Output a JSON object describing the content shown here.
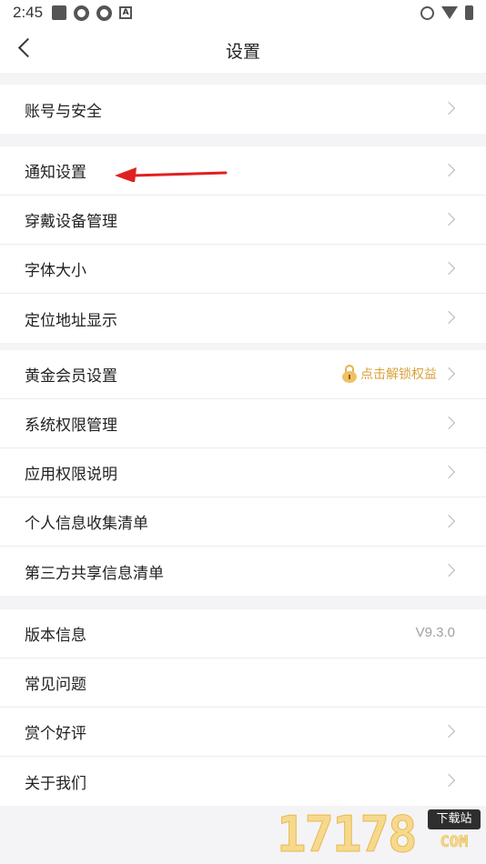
{
  "status_bar": {
    "time": "2:45",
    "left_icons": [
      "notification-square-icon",
      "app-circle-icon",
      "app-circle-icon",
      "app-a-icon"
    ],
    "right_icons": [
      "alarm-icon",
      "wifi-icon",
      "battery-icon"
    ]
  },
  "header": {
    "title": "设置",
    "back_icon": "chevron-left-icon"
  },
  "sections": [
    {
      "items": [
        {
          "label": "账号与安全"
        }
      ]
    },
    {
      "items": [
        {
          "label": "通知设置"
        },
        {
          "label": "穿戴设备管理"
        },
        {
          "label": "字体大小"
        },
        {
          "label": "定位地址显示"
        }
      ]
    },
    {
      "items": [
        {
          "label": "黄金会员设置",
          "extra": "点击解锁权益"
        },
        {
          "label": "系统权限管理"
        },
        {
          "label": "应用权限说明"
        },
        {
          "label": "个人信息收集清单"
        },
        {
          "label": "第三方共享信息清单"
        }
      ]
    },
    {
      "items": [
        {
          "label": "版本信息",
          "value": "V9.3.0"
        },
        {
          "label": "常见问题"
        },
        {
          "label": "赏个好评"
        },
        {
          "label": "关于我们"
        }
      ]
    }
  ],
  "annotation": {
    "arrow_color": "#e02020"
  },
  "watermark": {
    "number": "17178",
    "badge": "下载站",
    "suffix": "COM"
  },
  "colors": {
    "background": "#f4f4f6",
    "accent_gold": "#d9a13b"
  }
}
